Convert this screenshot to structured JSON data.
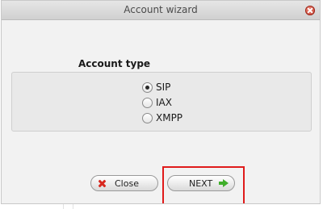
{
  "window": {
    "title": "Account wizard"
  },
  "account_type": {
    "label": "Account type",
    "options": [
      {
        "label": "SIP",
        "selected": true
      },
      {
        "label": "IAX",
        "selected": false
      },
      {
        "label": "XMPP",
        "selected": false
      }
    ]
  },
  "buttons": {
    "close_label": "Close",
    "next_label": "NEXT"
  },
  "colors": {
    "highlight": "#e01b1b",
    "close_icon": "#d8281f",
    "next_arrow": "#3fae2a"
  },
  "icons": {
    "close_button_icon": "x-icon",
    "next_button_icon": "arrow-right-icon",
    "titlebar_close": "window-close-icon"
  }
}
